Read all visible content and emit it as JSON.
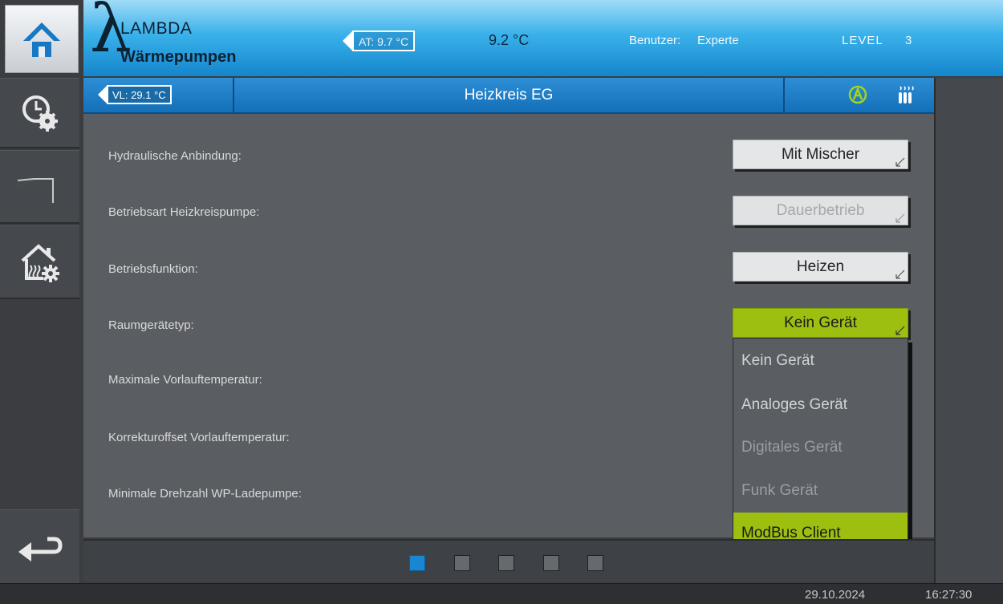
{
  "header": {
    "brand_line1": "LAMBDA",
    "brand_line2": "Wärmepumpen",
    "lambda_glyph": "λ",
    "outdoor_label": "AT:  9.7 °C",
    "outdoor_temp": "9.2 °C",
    "user_label": "Benutzer:",
    "user_value": "Experte",
    "level_label": "LEVEL",
    "level_value": "3"
  },
  "sidebar": {
    "items": [
      {
        "name": "home",
        "icon": "home-icon"
      },
      {
        "name": "schedule-settings",
        "icon": "clock-gear-icon"
      },
      {
        "name": "curve",
        "icon": "step-curve-icon"
      },
      {
        "name": "house-settings",
        "icon": "house-heating-gear-icon"
      },
      {
        "name": "back",
        "icon": "back-arrow-icon"
      }
    ]
  },
  "titlebar": {
    "vl_label": "VL: 29.1 °C",
    "title": "Heizkreis EG",
    "auto_icon": "auto-mode-icon",
    "radiator_icon": "radiator-icon",
    "accent": "#9dbf10"
  },
  "settings": {
    "rows": [
      {
        "label": "Hydraulische Anbindung:",
        "value": "Mit Mischer",
        "state": "normal"
      },
      {
        "label": "Betriebsart Heizkreispumpe:",
        "value": "Dauerbetrieb",
        "state": "disabled"
      },
      {
        "label": "Betriebsfunktion:",
        "value": "Heizen",
        "state": "normal"
      },
      {
        "label": "Raumgerätetyp:",
        "value": "Kein Gerät",
        "state": "active"
      },
      {
        "label": "Maximale Vorlauftemperatur:"
      },
      {
        "label": "Korrekturoffset Vorlauftemperatur:"
      },
      {
        "label": "Minimale Drehzahl WP-Ladepumpe:"
      }
    ]
  },
  "dropdown": {
    "options": [
      {
        "label": "Kein Gerät",
        "state": "enabled"
      },
      {
        "label": "Analoges Gerät",
        "state": "enabled"
      },
      {
        "label": "Digitales Gerät",
        "state": "disabled"
      },
      {
        "label": "Funk Gerät",
        "state": "disabled"
      },
      {
        "label": "ModBus Client",
        "state": "selected"
      }
    ]
  },
  "pager": {
    "pages": 5,
    "current": 1
  },
  "footer": {
    "date": "29.10.2024",
    "time": "16:27:30"
  }
}
